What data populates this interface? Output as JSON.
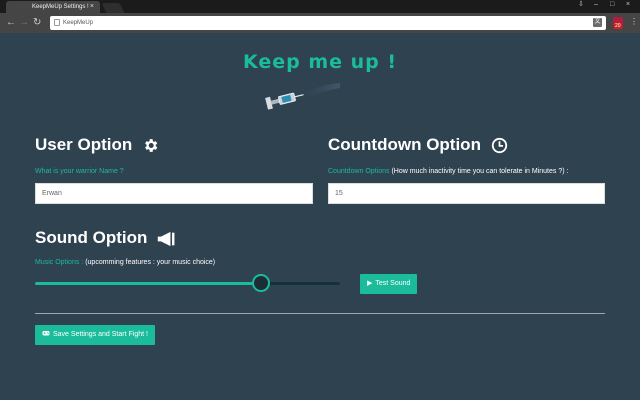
{
  "browser": {
    "tab_title": "KeepMeUp Settings !",
    "tab_close": "×",
    "back": "←",
    "forward": "→",
    "reload": "↻",
    "url": "KeepMeUp",
    "translate": "文",
    "ext_badge": "20",
    "menu": "⋮",
    "win_user": "⇩",
    "win_min": "–",
    "win_max": "□",
    "win_close": "×"
  },
  "page": {
    "title": "Keep me up !",
    "user_section": {
      "heading": "User Option",
      "label": "What is your warrior Name ?",
      "value": "Erwan"
    },
    "countdown_section": {
      "heading": "Countdown Option",
      "label": "Countdown Options",
      "label_rest": "(How much inactivity time you can tolerate in Minutes ?) :",
      "value": "15"
    },
    "sound_section": {
      "heading": "Sound Option",
      "label": "Music Options :",
      "label_rest": "(upcomming features : your music choice)",
      "volume_fraction": 0.74,
      "test_button": "Test Sound"
    },
    "save_button": "Save Settings and Start Fight !"
  },
  "colors": {
    "accent": "#1abc9c",
    "background": "#2f4250"
  }
}
